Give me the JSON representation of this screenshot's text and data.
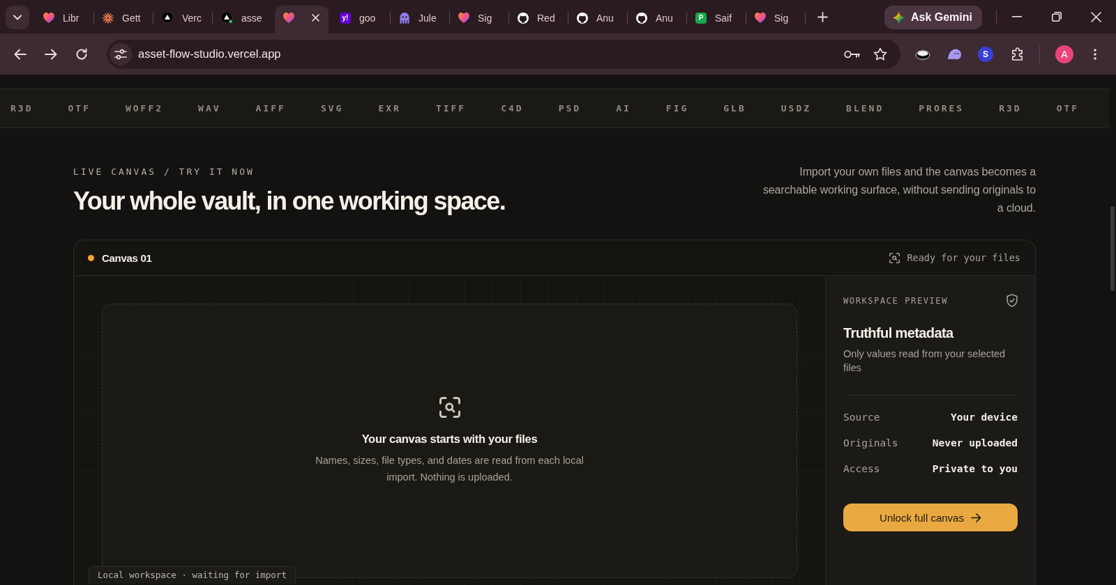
{
  "browser": {
    "tabs": [
      {
        "kind": "heart",
        "title": "Libr",
        "selected": false
      },
      {
        "kind": "starburst",
        "title": "Gett",
        "selected": false
      },
      {
        "kind": "triangle",
        "title": "Verc",
        "selected": false
      },
      {
        "kind": "triangle-dot",
        "title": "asse",
        "selected": false
      },
      {
        "kind": "heart",
        "selected": true
      },
      {
        "kind": "letter",
        "letter": "y!",
        "color": "#6001d2",
        "title": "goo",
        "selected": false
      },
      {
        "kind": "octopus",
        "title": "Jule",
        "selected": false
      },
      {
        "kind": "heart",
        "title": "Sig",
        "selected": false
      },
      {
        "kind": "cat",
        "title": "Red",
        "selected": false
      },
      {
        "kind": "cat",
        "title": "Anu",
        "selected": false
      },
      {
        "kind": "cat",
        "title": "Anu",
        "selected": false
      },
      {
        "kind": "letter",
        "letter": "P",
        "color": "#1aa64a",
        "title": "Saif",
        "selected": false
      },
      {
        "kind": "heart",
        "title": "Sig",
        "selected": false
      }
    ],
    "assistant_button": "Ask Gemini",
    "address": "asset-flow-studio.vercel.app",
    "extensions": [
      {
        "kind": "disc"
      },
      {
        "kind": "ghost"
      },
      {
        "kind": "letter",
        "letter": "S",
        "color": "#3b3fd8"
      },
      {
        "kind": "puzzle"
      }
    ],
    "profile_initial": "A"
  },
  "format_ticker": [
    "R3D",
    "OTF",
    "WOFF2",
    "WAV",
    "AIFF",
    "SVG",
    "EXR",
    "TIFF",
    "C4D",
    "PSD",
    "AI",
    "FIG",
    "GLB",
    "USDZ",
    "BLEND",
    "PRORES",
    "R3D",
    "OTF"
  ],
  "section": {
    "eyebrow": "LIVE CANVAS / TRY IT NOW",
    "title": "Your whole vault, in one working space.",
    "intro": "Import your own files and the canvas becomes a searchable working surface, without sending originals to a cloud."
  },
  "canvas": {
    "name": "Canvas 01",
    "status": "Ready for your files",
    "empty_title": "Your canvas starts with your files",
    "empty_text": "Names, sizes, file types, and dates are read from each local import. Nothing is uploaded.",
    "footer_label": "Local workspace · waiting for import"
  },
  "preview": {
    "eyebrow": "WORKSPACE PREVIEW",
    "title": "Truthful metadata",
    "text": "Only values read from your selected files",
    "facts": [
      {
        "label": "Source",
        "value": "Your device"
      },
      {
        "label": "Originals",
        "value": "Never uploaded"
      },
      {
        "label": "Access",
        "value": "Private to you"
      }
    ],
    "button": "Unlock full canvas"
  }
}
